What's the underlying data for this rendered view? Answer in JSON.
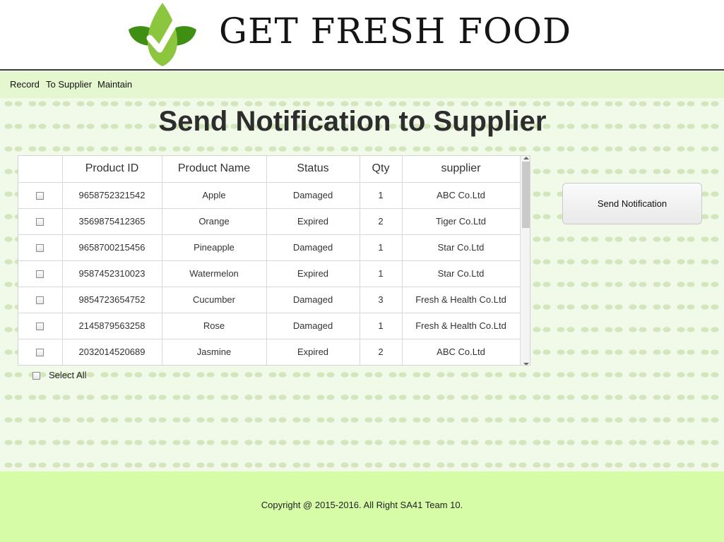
{
  "brand": {
    "title": "GET FRESH FOOD",
    "colors": {
      "leaf_dark": "#3f8f14",
      "leaf_light": "#8cc63f",
      "check": "#ffffff"
    }
  },
  "menu": {
    "items": [
      {
        "label": "Record"
      },
      {
        "label": "To Supplier"
      },
      {
        "label": "Maintain"
      }
    ]
  },
  "page": {
    "title": "Send Notification to Supplier"
  },
  "table": {
    "columns": [
      "",
      "Product ID",
      "Product Name",
      "Status",
      "Qty",
      "supplier"
    ],
    "rows": [
      {
        "checked": false,
        "product_id": "9658752321542",
        "product_name": "Apple",
        "status": "Damaged",
        "qty": "1",
        "supplier": "ABC Co.Ltd"
      },
      {
        "checked": false,
        "product_id": "3569875412365",
        "product_name": "Orange",
        "status": "Expired",
        "qty": "2",
        "supplier": "Tiger Co.Ltd"
      },
      {
        "checked": false,
        "product_id": "9658700215456",
        "product_name": "Pineapple",
        "status": "Damaged",
        "qty": "1",
        "supplier": "Star Co.Ltd"
      },
      {
        "checked": false,
        "product_id": "9587452310023",
        "product_name": "Watermelon",
        "status": "Expired",
        "qty": "1",
        "supplier": "Star Co.Ltd"
      },
      {
        "checked": false,
        "product_id": "9854723654752",
        "product_name": "Cucumber",
        "status": "Damaged",
        "qty": "3",
        "supplier": "Fresh & Health Co.Ltd"
      },
      {
        "checked": false,
        "product_id": "2145879563258",
        "product_name": "Rose",
        "status": "Damaged",
        "qty": "1",
        "supplier": "Fresh & Health Co.Ltd"
      },
      {
        "checked": false,
        "product_id": "2032014520689",
        "product_name": "Jasmine",
        "status": "Expired",
        "qty": "2",
        "supplier": "ABC Co.Ltd"
      }
    ]
  },
  "select_all": {
    "label": "Select All",
    "checked": false
  },
  "actions": {
    "send_label": "Send Notification"
  },
  "footer": {
    "text": "Copyright @ 2015-2016. All Right SA41 Team 10."
  },
  "colors": {
    "menubar_bg": "#e4f7cf",
    "footer_bg": "#d7fca8",
    "content_bg": "#f1f9e8"
  }
}
